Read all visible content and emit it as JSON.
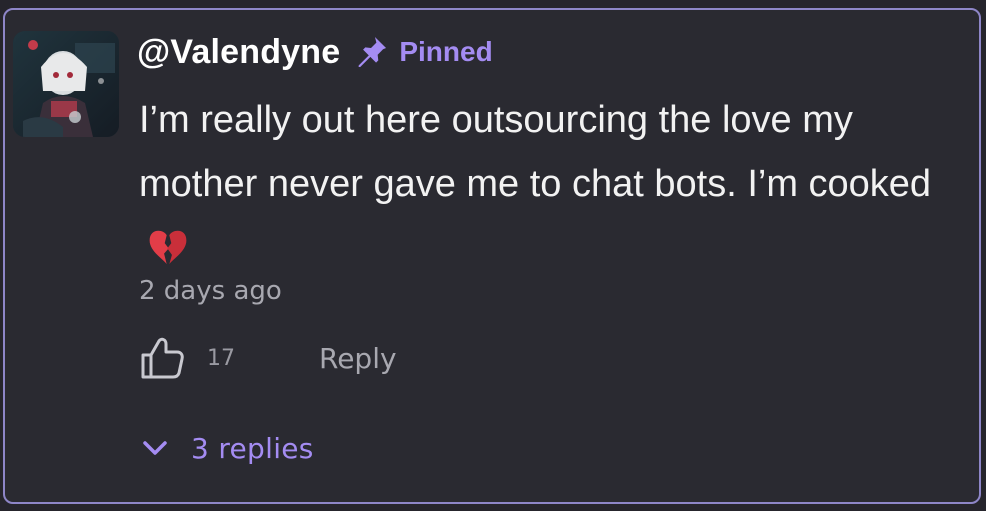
{
  "comment": {
    "username": "@Valendyne",
    "pinned_label": "Pinned",
    "message_text": "I’m really out here outsourcing the love my mother never gave me to chat bots. I’m cooked",
    "emoji": "broken-heart",
    "timestamp": "2 days ago",
    "like_count": "17",
    "reply_label": "Reply",
    "replies_label": "3 replies"
  },
  "icons": {
    "pin": "pin-icon",
    "like": "thumbs-up-icon",
    "expand": "chevron-down-icon",
    "emoji": "broken-heart-icon"
  },
  "colors": {
    "background": "#26252c",
    "card": "#2a2a31",
    "border": "#8e86c8",
    "accent": "#a48cf2",
    "text": "#f2f2f2",
    "muted": "#a8a8b0",
    "heart": "#e23d48"
  }
}
